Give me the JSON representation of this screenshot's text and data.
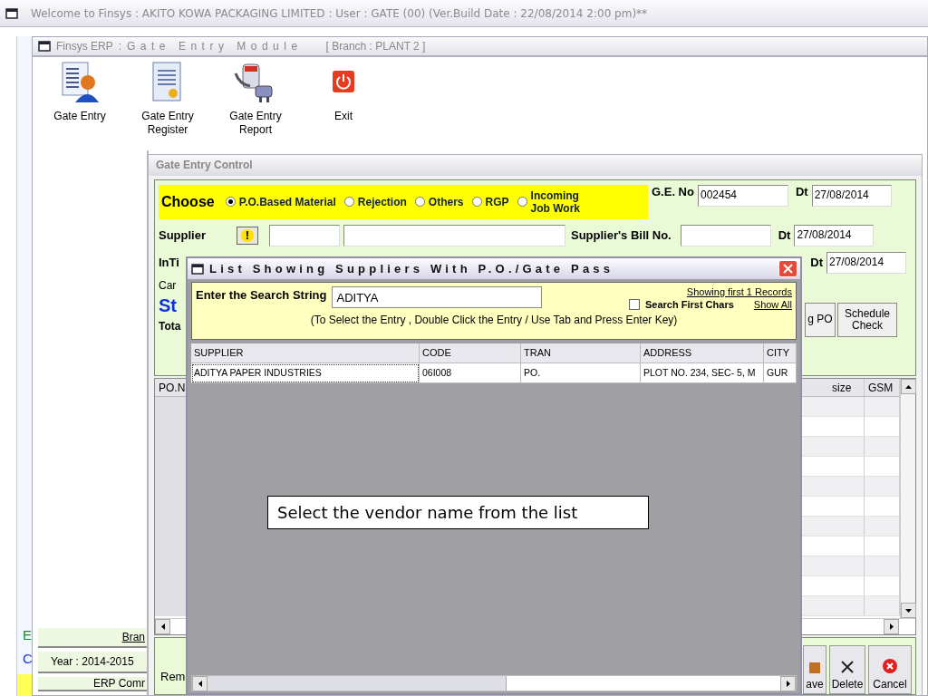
{
  "app_title": "Welcome to Finsys : AKITO KOWA PACKAGING LIMITED : User : GATE (00) (Ver.Build Date : 22/08/2014 2:00 pm)**",
  "module_window": {
    "title_app": "Finsys ERP",
    "title_sep": ":",
    "title_module": "Gate Entry Module",
    "branch": "[ Branch : PLANT 2 ]"
  },
  "toolbar": [
    {
      "label": "Gate Entry",
      "kind": "person"
    },
    {
      "label": "Gate Entry Register",
      "kind": "document"
    },
    {
      "label": "Gate Entry Report",
      "kind": "plug"
    },
    {
      "label": "Exit",
      "kind": "power"
    }
  ],
  "outer_strip": [
    {
      "text": "E",
      "color": "#1a8a2a"
    },
    {
      "text": "C",
      "color": "#1a3ad0"
    }
  ],
  "side_panel": {
    "branch": "Bran",
    "year": "Year : 2014-2015",
    "footer": "ERP Comr"
  },
  "control_window": {
    "title": "Gate Entry Control",
    "choose_label": "Choose",
    "options": [
      {
        "label": "P.O.Based Material",
        "selected": true
      },
      {
        "label": "Rejection",
        "selected": false
      },
      {
        "label": "Others",
        "selected": false
      },
      {
        "label": "RGP",
        "selected": false
      },
      {
        "label": "Incoming Job Work",
        "selected": false
      }
    ],
    "ge_no_label": "G.E. No",
    "ge_no": "002454",
    "dt_label": "Dt",
    "dt": "27/08/2014",
    "supplier_label": "Supplier",
    "warning": "!",
    "bill_label": "Supplier's Bill No.",
    "bill_dt_label": "Dt",
    "bill_dt": "27/08/2014",
    "intime_label": "InTi",
    "third_dt_label": "Dt",
    "third_dt": "27/08/2014",
    "car_label": "Car",
    "status_label": "St",
    "total_label": "Tota",
    "po_button": "g PO",
    "schedule_button": "Schedule Check",
    "grid": {
      "left_column": "PO.N",
      "right_columns": [
        "size",
        "GSM"
      ]
    },
    "remarks_label": "Rem",
    "buttons": [
      {
        "label": "ave",
        "kind": "save"
      },
      {
        "label": "Delete",
        "kind": "delete"
      },
      {
        "label": "Cancel",
        "kind": "cancel"
      }
    ]
  },
  "dialog": {
    "title": "List Showing Suppliers With P.O./Gate Pass",
    "search_label": "Enter the Search String",
    "search_value": "ADITYA",
    "records_link": "Showing first 1 Records",
    "search_first": {
      "label": "Search First Chars",
      "checked": false
    },
    "show_all": "Show All",
    "hint": "(To Select the Entry , Double Click the Entry / Use Tab and Press Enter Key)",
    "columns": [
      "SUPPLIER",
      "CODE",
      "TRAN",
      "ADDRESS",
      "CITY"
    ],
    "rows": [
      [
        "ADITYA PAPER INDUSTRIES",
        "06I008",
        "PO.",
        "PLOT NO. 234, SEC- 5, M",
        "GUR"
      ]
    ]
  },
  "callout": "Select the vendor name from the list"
}
